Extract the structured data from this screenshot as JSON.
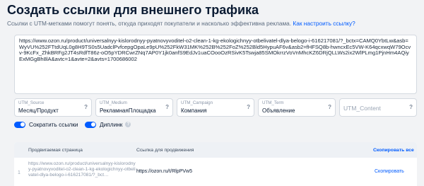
{
  "header": {
    "title": "Создать ссылки для внешнего трафика",
    "subtitle": "Ссылки с UTM-метками помогут понять, откуда приходят покупатели и насколько эффективна реклама.",
    "help_link": "Как настроить ссылку?"
  },
  "url_input": {
    "value": "https://www.ozon.ru/product/universalnyy-kislorodnyy-pyatnovyvoditel-o2-clean-1-kg-ekologichnyy-otbelivatel-dlya-belogo-i-616217081/?_bctx=CAMQ0YbtLw&asb=WyVU%252FTtdUqL0g8H9TS0s5UadclPvfcepgOpaLe9pU%252FkW31MK%252B%252FoZ%252Bld5HypuAF6v&asb2=fHFSQ8b-hwncxEc5VW-K64qcxwqW79Ocvv-9KcFx_ZhkBRFg2JT4sRdfT86z-oO5pYDRCwrZNq7AP0Y1jk0anfS9EdJv1uaCOooOzRSivK5Tswja85SMOkrrzVoVnMhcKZ6DRjQLLWs2ix2WlPLmg1PjnHm4AQiyExMGgBh8lA&avtc=1&avte=2&avts=1700686002"
  },
  "utm_fields": [
    {
      "label": "UTM_Source",
      "value": "Месяц/Продукт",
      "help": "?"
    },
    {
      "label": "UTM_Medium",
      "value": "РекламнаяПлощадка",
      "help": "?"
    },
    {
      "label": "UTM_Campaign",
      "value": "Компания",
      "help": "?"
    },
    {
      "label": "UTM_Term",
      "value": "Объявление",
      "help": "?"
    },
    {
      "label": "",
      "placeholder": "UTM_Content",
      "value": "",
      "help": "?"
    }
  ],
  "toggles": [
    {
      "label": "Сократить ссылки",
      "on": true
    },
    {
      "label": "Диплинк",
      "on": true,
      "info": "?"
    }
  ],
  "table": {
    "columns": {
      "page": "Продвигаемая страница",
      "link": "Ссылка для продвижения",
      "copy_all": "Скопировать все"
    },
    "rows": [
      {
        "num": "1",
        "page": "https://www.ozon.ru/product/universalnyy-kislorodnyy-pyatnovyvoditel-o2-clean-1-kg-ekologichnyy-otbelivatel-dlya-belogo-i-616217081/?_bct…",
        "short_link": "https://ozon.ru/t/RlpPVw5",
        "copy": "Скопировать"
      }
    ]
  },
  "colors": {
    "accent": "#005bff",
    "background": "#f2f3f5",
    "text": "#001a34"
  }
}
